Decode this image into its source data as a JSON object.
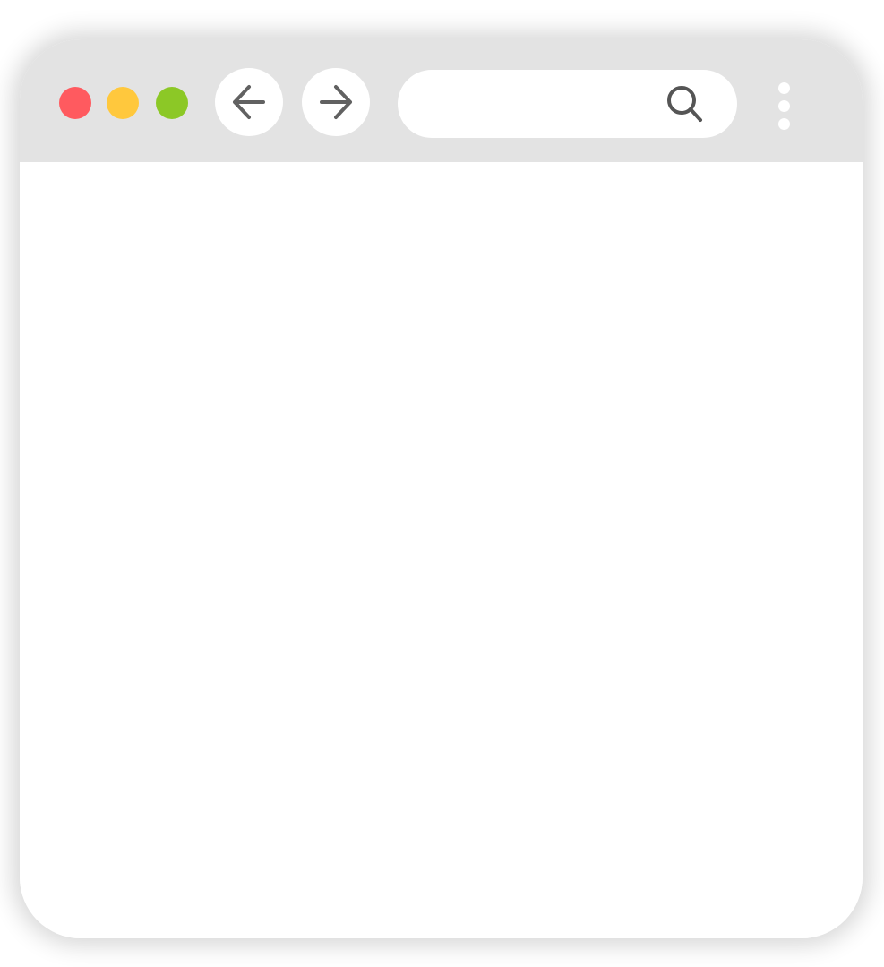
{
  "window": {
    "controls": {
      "close_color": "#ff5a5f",
      "minimize_color": "#ffc83d",
      "maximize_color": "#8cc826"
    },
    "toolbar_color": "#e3e3e3"
  },
  "navigation": {
    "back_icon": "arrow-left-icon",
    "forward_icon": "arrow-right-icon"
  },
  "address_bar": {
    "value": "",
    "placeholder": "",
    "search_icon": "search-icon"
  },
  "menu": {
    "icon": "kebab-menu-icon"
  }
}
